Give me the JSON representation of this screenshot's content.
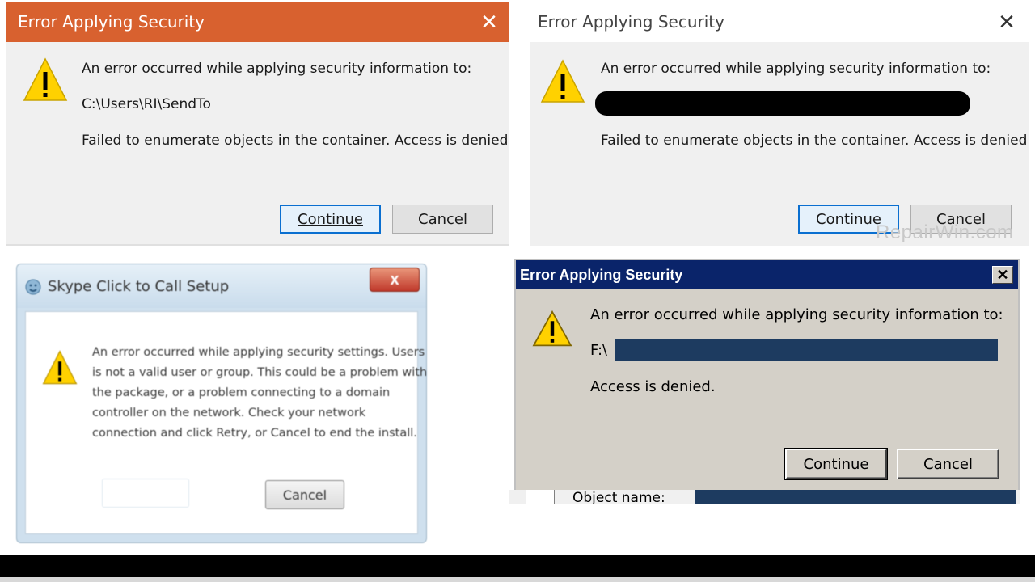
{
  "dialog1": {
    "title": "Error Applying Security",
    "close_glyph": "✕",
    "message": "An error occurred while applying security information to:",
    "path": "C:\\Users\\RI\\SendTo",
    "detail": "Failed to enumerate objects in the container. Access is denied.",
    "continue_label": "Continue",
    "cancel_label": "Cancel",
    "colors": {
      "titlebar": "#d8612f"
    }
  },
  "dialog2": {
    "title": "Error Applying Security",
    "close_glyph": "✕",
    "message": "An error occurred while applying security information to:",
    "detail": "Failed to enumerate objects in the container. Access is denied.",
    "continue_label": "Continue",
    "cancel_label": "Cancel",
    "watermark": "RepairWin.com"
  },
  "dialog3": {
    "title": "Skype Click to Call Setup",
    "close_glyph": "x",
    "message_lines": [
      "An error occurred while applying security settings. Users",
      "is not a valid user or group. This could be a problem with",
      "the package, or a problem connecting to a domain",
      "controller on the network. Check your network",
      "connection and click Retry, or Cancel to end the install."
    ],
    "cancel_label": "Cancel"
  },
  "dialog4": {
    "title": "Error Applying Security",
    "close_glyph": "✕",
    "message": "An error occurred while applying security information to:",
    "path": "F:\\",
    "detail": "Access is denied.",
    "continue_label": "Continue",
    "cancel_label": "Cancel",
    "colors": {
      "titlebar": "#0a246a"
    }
  },
  "underlay": {
    "label": "Object name:"
  },
  "icons": {
    "warning": "warning-icon",
    "close": "close-icon",
    "app": "skype-icon"
  }
}
